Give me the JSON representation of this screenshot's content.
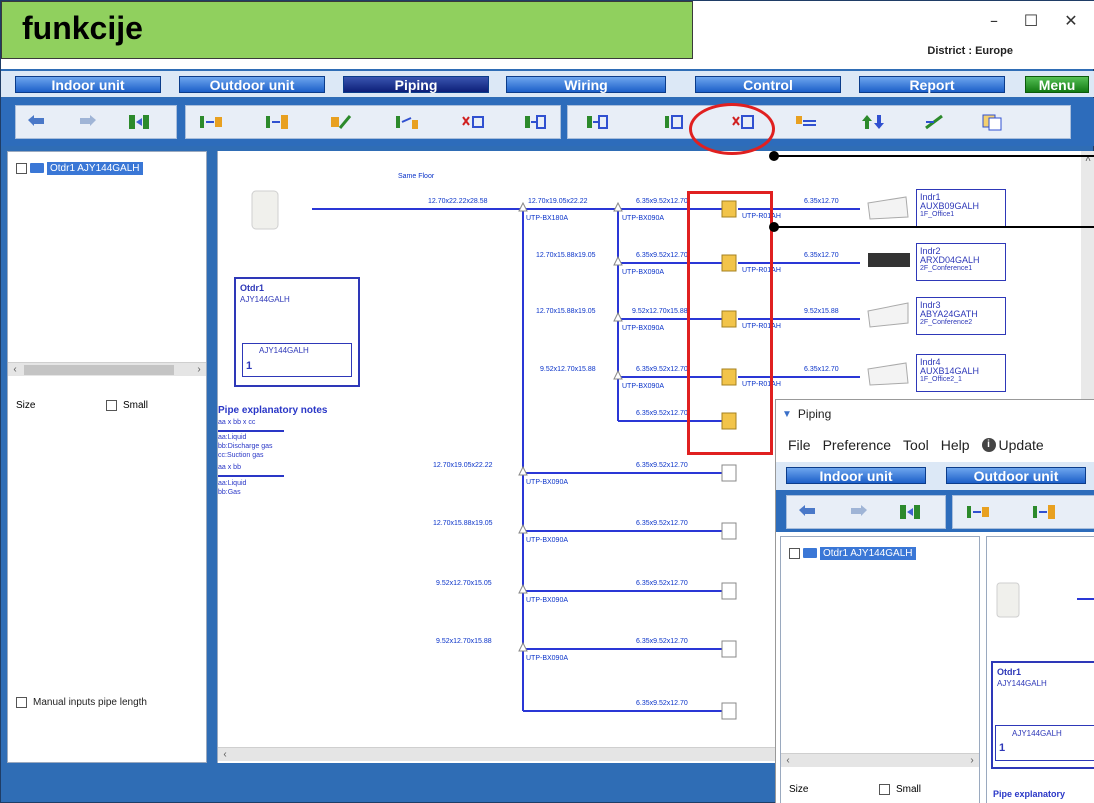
{
  "window": {
    "title_controls": [
      "–",
      "☐",
      "✕"
    ],
    "district": "District : Europe"
  },
  "overlay": {
    "heading": "funkcije"
  },
  "main_tabs": [
    "Indoor unit",
    "Outdoor unit",
    "Piping",
    "Wiring",
    "Control",
    "Report",
    "Menu"
  ],
  "tree": {
    "item": "Otdr1 AJY144GALH"
  },
  "left_panel": {
    "size_label": "Size",
    "small_label": "Small",
    "manual_label": "Manual inputs pipe length"
  },
  "diagram": {
    "same_floor": "Same Floor",
    "otdr_name": "Otdr1",
    "otdr_model": "AJY144GALH",
    "otdr_inner_model": "AJY144GALH",
    "otdr_inner_num": "1",
    "main_pipe": "12.70x22.22x28.58",
    "trunk_labels": [
      "12.70x19.05x22.22",
      "12.70x15.88x19.05",
      "12.70x15.88x19.05",
      "9.52x12.70x15.88",
      "12.70x19.05x22.22",
      "12.70x15.88x19.05",
      "9.52x12.70x15.05",
      "9.52x12.70x15.88"
    ],
    "branch_kit_a": "UTP-BX180A",
    "branch_kit_b": "UTP-BX090A",
    "row_pipes": [
      "6.35x9.52x12.70",
      "6.35x9.52x12.70",
      "9.52x12.70x15.88",
      "6.35x9.52x12.70",
      "6.35x9.52x12.70",
      "6.35x9.52x12.70",
      "6.35x9.52x12.70",
      "6.35x9.52x12.70",
      "6.35x9.52x12.70",
      "6.35x9.52x12.70"
    ],
    "header_kit": "UTP-R01AH",
    "indoor_pipes": [
      "6.35x12.70",
      "6.35x12.70",
      "9.52x15.88",
      "6.35x12.70"
    ],
    "indoor_units": [
      {
        "name": "Indr1",
        "model": "AUXB09GALH",
        "loc": "1F_Office1"
      },
      {
        "name": "Indr2",
        "model": "ARXD04GALH",
        "loc": "2F_Conference1"
      },
      {
        "name": "Indr3",
        "model": "ABYA24GATH",
        "loc": "2F_Conference2"
      },
      {
        "name": "Indr4",
        "model": "AUXB14GALH",
        "loc": "1F_Office2_1"
      }
    ],
    "notes_title": "Pipe explanatory notes",
    "notes_a": "aa x bb x cc",
    "notes_a_items": [
      "aa:Liquid",
      "bb:Discharge gas",
      "cc:Suction gas"
    ],
    "notes_b": "aa x bb",
    "notes_b_items": [
      "aa:Liquid",
      "bb:Gas"
    ]
  },
  "sub_window": {
    "title": "Piping",
    "menu": [
      "File",
      "Preference",
      "Tool",
      "Help",
      "Update"
    ],
    "tabs": [
      "Indoor unit",
      "Outdoor unit"
    ],
    "tree_item": "Otdr1 AJY144GALH",
    "size_label": "Size",
    "small_label": "Small",
    "otdr_name": "Otdr1",
    "otdr_model": "AJY144GALH",
    "otdr_inner_model": "AJY144GALH",
    "otdr_inner_num": "1",
    "notes_title": "Pipe explanatory"
  }
}
